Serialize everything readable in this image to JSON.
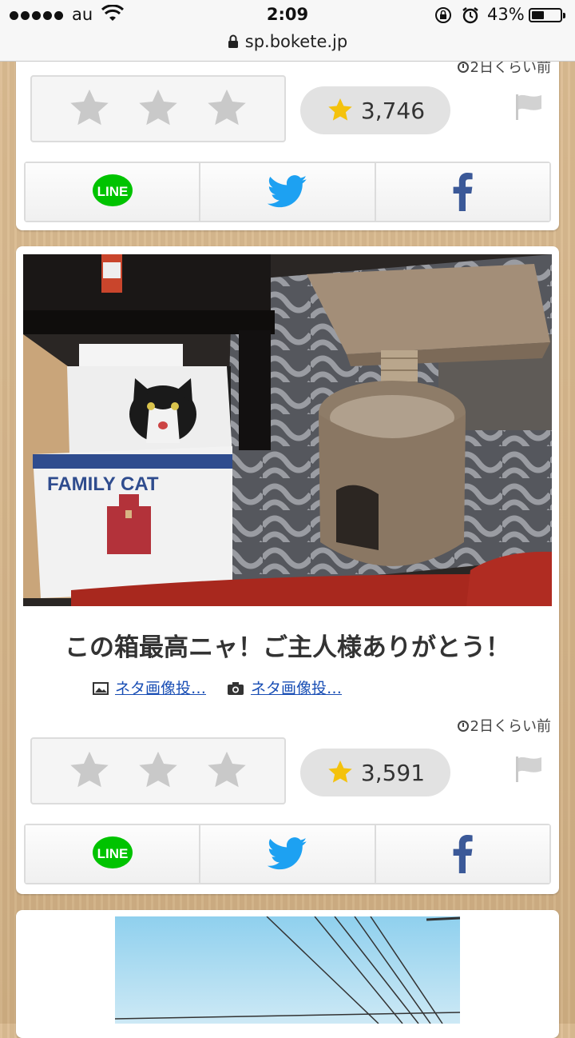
{
  "status_bar": {
    "carrier": "au",
    "time": "2:09",
    "battery_percent": "43%",
    "battery_level": 0.43,
    "url": "sp.bokete.jp"
  },
  "post_top": {
    "time_ago": "2日くらい前",
    "score": "3,746",
    "share": [
      "LINE",
      "twitter",
      "facebook"
    ]
  },
  "post_main": {
    "image_text": "FAMILY CAT",
    "caption": "この箱最高ニャ！ご主人様ありがとう！",
    "link_image": "ネタ画像投…",
    "link_camera": "ネタ画像投…",
    "time_ago": "2日くらい前",
    "score": "3,591",
    "share_line": "LINE"
  },
  "colors": {
    "line_green": "#00c300",
    "twitter_blue": "#1da1f2",
    "facebook_blue": "#3b5998",
    "star_gold": "#f4c20d"
  }
}
